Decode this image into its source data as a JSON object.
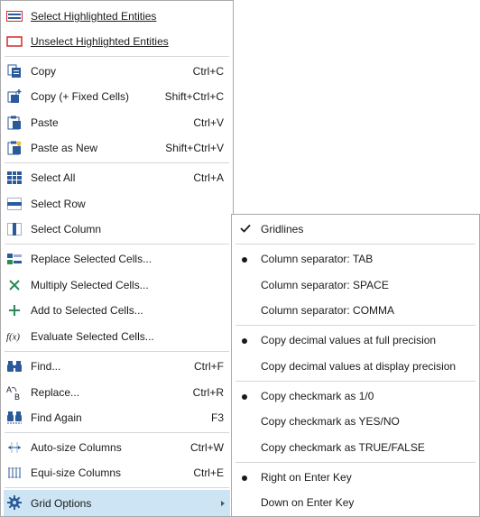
{
  "main_menu": {
    "select_highlighted": {
      "label": "Select Highlighted Entities"
    },
    "unselect_highlighted": {
      "label": "Unselect Highlighted Entities"
    },
    "copy": {
      "label": "Copy",
      "shortcut": "Ctrl+C"
    },
    "copy_fixed": {
      "label": "Copy (+ Fixed Cells)",
      "shortcut": "Shift+Ctrl+C"
    },
    "paste": {
      "label": "Paste",
      "shortcut": "Ctrl+V"
    },
    "paste_new": {
      "label": "Paste as New",
      "shortcut": "Shift+Ctrl+V"
    },
    "select_all": {
      "label": "Select All",
      "shortcut": "Ctrl+A"
    },
    "select_row": {
      "label": "Select Row"
    },
    "select_column": {
      "label": "Select Column"
    },
    "replace_cells": {
      "label": "Replace Selected Cells..."
    },
    "multiply_cells": {
      "label": "Multiply Selected Cells..."
    },
    "add_cells": {
      "label": "Add to Selected Cells..."
    },
    "evaluate_cells": {
      "label": "Evaluate Selected Cells..."
    },
    "find": {
      "label": "Find...",
      "shortcut": "Ctrl+F"
    },
    "replace": {
      "label": "Replace...",
      "shortcut": "Ctrl+R"
    },
    "find_again": {
      "label": "Find Again",
      "shortcut": "F3"
    },
    "autosize": {
      "label": "Auto-size Columns",
      "shortcut": "Ctrl+W"
    },
    "equisize": {
      "label": "Equi-size Columns",
      "shortcut": "Ctrl+E"
    },
    "grid_options": {
      "label": "Grid Options"
    }
  },
  "grid_options_menu": {
    "gridlines": {
      "label": "Gridlines",
      "state": "checked"
    },
    "sep_tab": {
      "label": "Column separator: TAB",
      "state": "selected"
    },
    "sep_space": {
      "label": "Column separator: SPACE"
    },
    "sep_comma": {
      "label": "Column separator: COMMA"
    },
    "full_precision": {
      "label": "Copy decimal values at full precision",
      "state": "selected"
    },
    "display_precision": {
      "label": "Copy decimal values at display precision"
    },
    "check_10": {
      "label": "Copy checkmark as 1/0",
      "state": "selected"
    },
    "check_yesno": {
      "label": "Copy checkmark as YES/NO"
    },
    "check_truefalse": {
      "label": "Copy checkmark as TRUE/FALSE"
    },
    "right_enter": {
      "label": "Right on Enter Key",
      "state": "selected"
    },
    "down_enter": {
      "label": "Down on Enter Key"
    }
  },
  "colors": {
    "highlight": "#cce4f3",
    "icon_blue": "#2b5a9a",
    "icon_red": "#d22a2a",
    "icon_green": "#2a8a5a"
  },
  "icons": [
    "select-highlighted-icon",
    "unselect-highlighted-icon",
    "copy-icon",
    "copy-fixed-icon",
    "paste-icon",
    "paste-new-icon",
    "select-all-icon",
    "select-row-icon",
    "select-column-icon",
    "replace-cells-icon",
    "multiply-icon",
    "add-icon",
    "function-icon",
    "binoculars-icon",
    "replace-icon",
    "find-again-icon",
    "autosize-columns-icon",
    "equisize-columns-icon",
    "gear-icon"
  ]
}
